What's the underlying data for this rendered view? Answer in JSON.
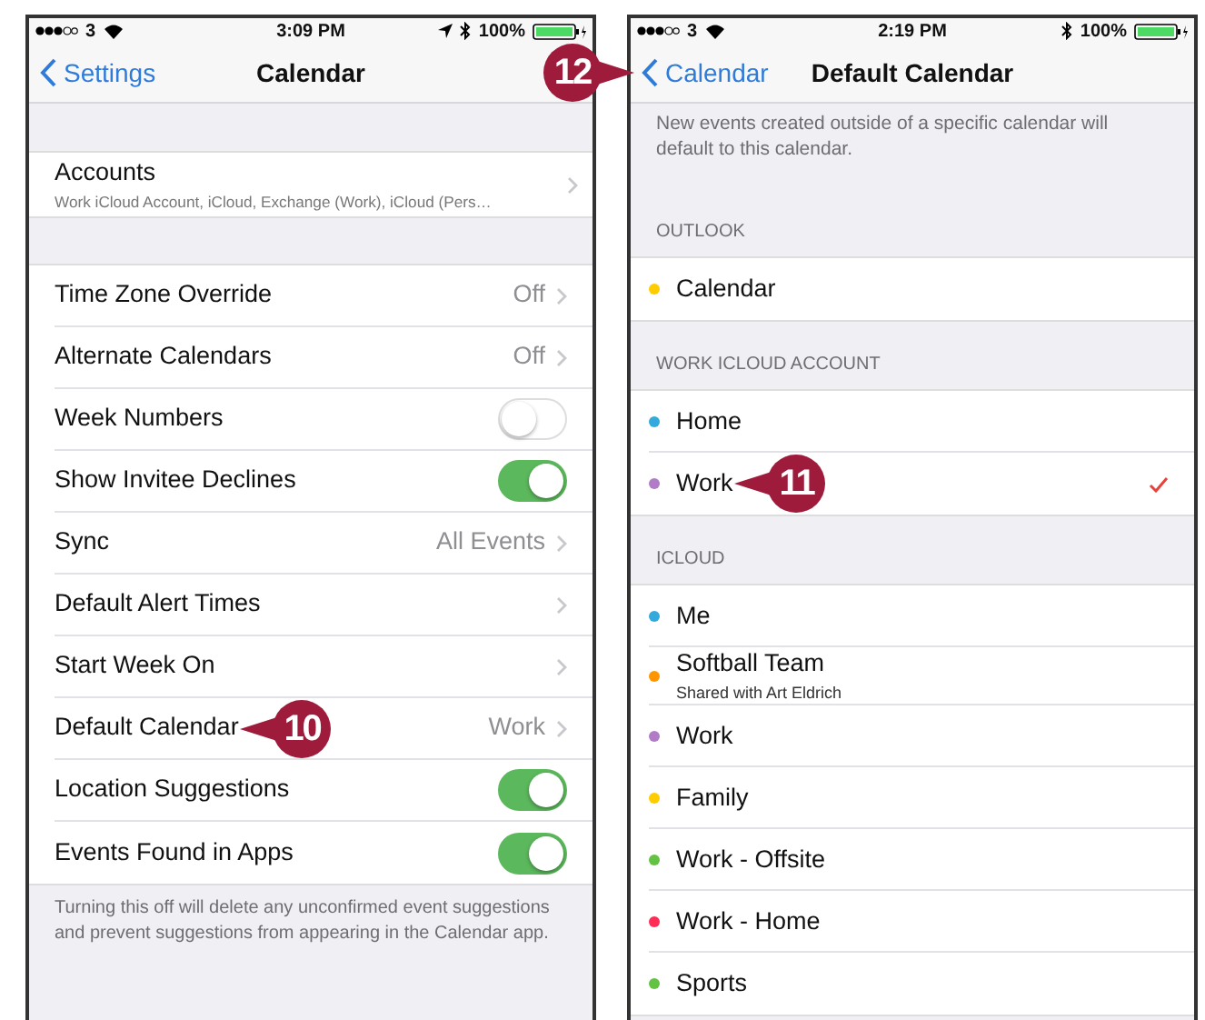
{
  "left_screen": {
    "status_bar": {
      "carrier": "3",
      "time": "3:09 PM",
      "location": true,
      "battery": "100%"
    },
    "nav": {
      "back": "Settings",
      "title": "Calendar"
    },
    "groups": [
      {
        "rows": [
          {
            "kind": "link",
            "label": "Accounts",
            "subtitle": "Work iCloud Account, iCloud, Exchange (Work), iCloud (Pers…"
          }
        ]
      },
      {
        "rows": [
          {
            "kind": "link",
            "label": "Time Zone Override",
            "value": "Off"
          },
          {
            "kind": "link",
            "label": "Alternate Calendars",
            "value": "Off"
          },
          {
            "kind": "toggle",
            "label": "Week Numbers",
            "on": false
          },
          {
            "kind": "toggle",
            "label": "Show Invitee Declines",
            "on": true
          },
          {
            "kind": "link",
            "label": "Sync",
            "value": "All Events"
          },
          {
            "kind": "link",
            "label": "Default Alert Times"
          },
          {
            "kind": "link",
            "label": "Start Week On"
          },
          {
            "kind": "link",
            "label": "Default Calendar",
            "value": "Work",
            "callout": "10"
          },
          {
            "kind": "toggle",
            "label": "Location Suggestions",
            "on": true
          },
          {
            "kind": "toggle",
            "label": "Events Found in Apps",
            "on": true
          }
        ],
        "footer": "Turning this off will delete any unconfirmed event suggestions and prevent suggestions from appearing in the Calendar app."
      }
    ]
  },
  "right_screen": {
    "status_bar": {
      "carrier": "3",
      "time": "2:19 PM",
      "location": false,
      "battery": "100%"
    },
    "nav": {
      "back": "Calendar",
      "title": "Default Calendar",
      "callout": "12"
    },
    "description": "New events created outside of a specific calendar will default to this calendar.",
    "sections": [
      {
        "header": "OUTLOOK",
        "calendars": [
          {
            "name": "Calendar",
            "color": "#ffcc00",
            "selected": false
          }
        ]
      },
      {
        "header": "WORK ICLOUD ACCOUNT",
        "calendars": [
          {
            "name": "Home",
            "color": "#34aadc",
            "selected": false
          },
          {
            "name": "Work",
            "color": "#b17cc6",
            "selected": true,
            "callout": "11"
          }
        ]
      },
      {
        "header": "ICLOUD",
        "calendars": [
          {
            "name": "Me",
            "color": "#34aadc",
            "selected": false
          },
          {
            "name": "Softball Team",
            "subtitle": "Shared with Art Eldrich",
            "color": "#ff9500",
            "selected": false
          },
          {
            "name": "Work",
            "color": "#b17cc6",
            "selected": false
          },
          {
            "name": "Family",
            "color": "#ffcc00",
            "selected": false
          },
          {
            "name": "Work - Offsite",
            "color": "#63c244",
            "selected": false
          },
          {
            "name": "Work - Home",
            "color": "#ff2d55",
            "selected": false
          },
          {
            "name": "Sports",
            "color": "#63c244",
            "selected": false
          }
        ]
      }
    ]
  }
}
